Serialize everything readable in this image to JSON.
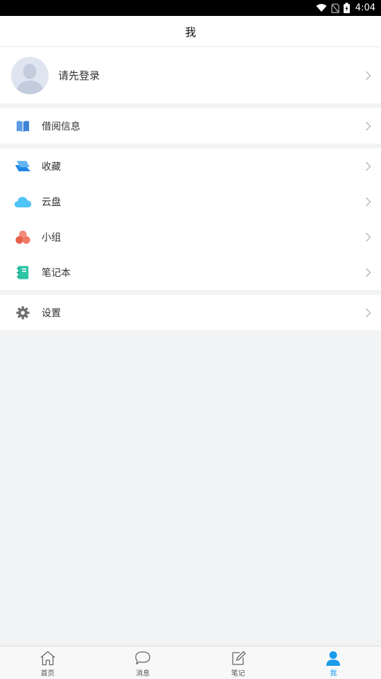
{
  "status_bar": {
    "time": "4:04"
  },
  "nav": {
    "title": "我"
  },
  "profile": {
    "label": "请先登录"
  },
  "menu": {
    "group1": [
      {
        "id": "borrow",
        "label": "借阅信息",
        "icon": "book-icon",
        "color": "#4a90e2"
      }
    ],
    "group2": [
      {
        "id": "favorites",
        "label": "收藏",
        "icon": "favorites-icon",
        "color": "#1e88e5"
      },
      {
        "id": "cloud",
        "label": "云盘",
        "icon": "cloud-icon",
        "color": "#4fc3f7"
      },
      {
        "id": "group",
        "label": "小组",
        "icon": "group-icon",
        "color": "#ef7563"
      },
      {
        "id": "notebook",
        "label": "笔记本",
        "icon": "notebook-icon",
        "color": "#2ec4a6"
      }
    ],
    "group3": [
      {
        "id": "settings",
        "label": "设置",
        "icon": "gear-icon",
        "color": "#777777"
      }
    ]
  },
  "tabs": [
    {
      "label": "首页",
      "icon": "home-icon",
      "active": false
    },
    {
      "label": "消息",
      "icon": "message-icon",
      "active": false
    },
    {
      "label": "笔记",
      "icon": "note-icon",
      "active": false
    },
    {
      "label": "我",
      "icon": "person-icon",
      "active": true
    }
  ],
  "colors": {
    "accent": "#1a9bea",
    "background": "#f2f3f5"
  }
}
